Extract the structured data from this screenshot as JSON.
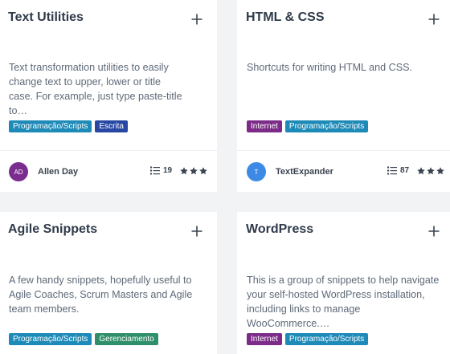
{
  "cards": [
    {
      "title": "Text Utilities",
      "description": "Text transformation utilities to easily change text to upper, lower or title case. For example, just type paste-title to…",
      "tags": [
        {
          "label": "Programação/Scripts",
          "color": "#1d8ab7"
        },
        {
          "label": "Escrita",
          "color": "#2747a3"
        }
      ],
      "author": {
        "name": "Allen Day",
        "initials": "AD",
        "color": "#7b2c8f"
      },
      "snippet_count": "19",
      "rating": 3
    },
    {
      "title": "HTML & CSS",
      "description": "Shortcuts for writing HTML and CSS.",
      "tags": [
        {
          "label": "Internet",
          "color": "#7c2c88"
        },
        {
          "label": "Programação/Scripts",
          "color": "#1d8ab7"
        }
      ],
      "author": {
        "name": "TextExpander",
        "initials": "T",
        "color": "#3d8ae6"
      },
      "snippet_count": "87",
      "rating": 3
    },
    {
      "title": "Agile Snippets",
      "description": "A few handy snippets, hopefully useful to Agile Coaches, Scrum Masters and Agile team members.",
      "tags": [
        {
          "label": "Programação/Scripts",
          "color": "#1d8ab7"
        },
        {
          "label": "Gerenciamento",
          "color": "#2f8f6a"
        }
      ]
    },
    {
      "title": "WordPress",
      "description": "This is a group of snippets to help navigate your self-hosted WordPress installation, including links to manage WooCommerce.…",
      "tags": [
        {
          "label": "Internet",
          "color": "#7c2c88"
        },
        {
          "label": "Programação/Scripts",
          "color": "#1d8ab7"
        }
      ]
    }
  ],
  "icons": {
    "add": "plus-icon",
    "list": "list-icon",
    "star": "star-icon"
  }
}
